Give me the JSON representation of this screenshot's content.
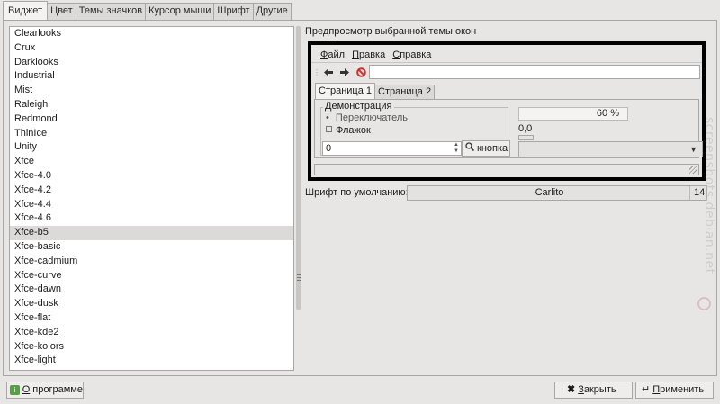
{
  "tabs": [
    "Виджет",
    "Цвет",
    "Темы значков",
    "Курсор мыши",
    "Шрифт",
    "Другие"
  ],
  "themes": [
    "Clearlooks",
    "Crux",
    "Darklooks",
    "Industrial",
    "Mist",
    "Raleigh",
    "Redmond",
    "ThinIce",
    "Unity",
    "Xfce",
    "Xfce-4.0",
    "Xfce-4.2",
    "Xfce-4.4",
    "Xfce-4.6",
    "Xfce-b5",
    "Xfce-basic",
    "Xfce-cadmium",
    "Xfce-curve",
    "Xfce-dawn",
    "Xfce-dusk",
    "Xfce-flat",
    "Xfce-kde2",
    "Xfce-kolors",
    "Xfce-light"
  ],
  "selected_theme": "Xfce-b5",
  "preview": {
    "title": "Предпросмотр выбранной темы окон",
    "menu": [
      "Файл",
      "Правка",
      "Справка"
    ],
    "tabs": [
      "Страница 1",
      "Страница 2"
    ],
    "frame_label": "Демонстрация",
    "radio_label": "Переключатель",
    "check_label": "Флажок",
    "spin_value": "0",
    "button_label": "кнопка",
    "progress_text": "60 %",
    "progress_value": 0.6,
    "scale_value": "0,0"
  },
  "font": {
    "label": "Шрифт по умолчанию:",
    "name": "Carlito",
    "size": "14"
  },
  "buttons": {
    "about": "О программе",
    "close": "Закрыть",
    "apply": "Применить"
  },
  "watermark": "screenshots.debian.net"
}
